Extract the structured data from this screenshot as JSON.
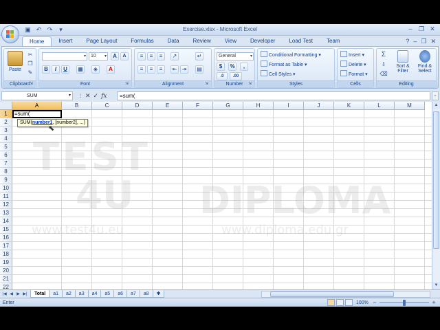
{
  "window": {
    "title": "Exercise.xlsx - Microsoft Excel"
  },
  "ribbon": {
    "tabs": [
      "Home",
      "Insert",
      "Page Layout",
      "Formulas",
      "Data",
      "Review",
      "View",
      "Developer",
      "Load Test",
      "Team"
    ],
    "active_tab": "Home",
    "clipboard": {
      "label": "Clipboard",
      "paste": "Paste"
    },
    "font": {
      "label": "Font",
      "name": "",
      "size": "10",
      "bold": "B",
      "italic": "I",
      "underline": "U"
    },
    "alignment": {
      "label": "Alignment"
    },
    "number": {
      "label": "Number",
      "format": "General",
      "currency": "$",
      "percent": "%",
      "comma": ",",
      "inc": ".0",
      "dec": ".00"
    },
    "styles": {
      "label": "Styles",
      "conditional": "Conditional Formatting",
      "table": "Format as Table",
      "cell_styles": "Cell Styles"
    },
    "cells": {
      "label": "Cells",
      "insert": "Insert",
      "delete": "Delete",
      "format": "Format"
    },
    "editing": {
      "label": "Editing",
      "sum": "Σ",
      "sort": "Sort &",
      "sort2": "Filter",
      "find": "Find &",
      "find2": "Select"
    }
  },
  "formula_bar": {
    "name_box": "SUM",
    "content": "=sum("
  },
  "grid": {
    "columns": [
      "A",
      "B",
      "C",
      "D",
      "E",
      "F",
      "G",
      "H",
      "I",
      "J",
      "K",
      "L",
      "M"
    ],
    "rows": [
      "1",
      "2",
      "3",
      "4",
      "5",
      "6",
      "7",
      "8",
      "9",
      "10",
      "11",
      "12",
      "13",
      "14",
      "15",
      "16",
      "17",
      "18",
      "19",
      "20",
      "21",
      "22"
    ],
    "active_col": "A",
    "active_row": "1",
    "active_value": "=sum(",
    "tooltip": {
      "fn": "SUM(",
      "arg1": "number1",
      "rest": ", [number2], ...)"
    }
  },
  "watermark": {
    "line1": "TEST",
    "line2": "4U",
    "brand": "DIPLOMA",
    "url1": "www.test4u.eu",
    "url2": "www.diploma.edu.gr"
  },
  "sheets": [
    "Total",
    "a1",
    "a2",
    "a3",
    "a4",
    "a5",
    "a6",
    "a7",
    "a8"
  ],
  "active_sheet": "Total",
  "status": {
    "mode": "Enter",
    "zoom": "100%",
    "zoom_level": 0.5
  },
  "colors": {
    "accent": "#15428b",
    "ribbon": "#dbe6f4",
    "selected_header": "#f1c15f"
  }
}
